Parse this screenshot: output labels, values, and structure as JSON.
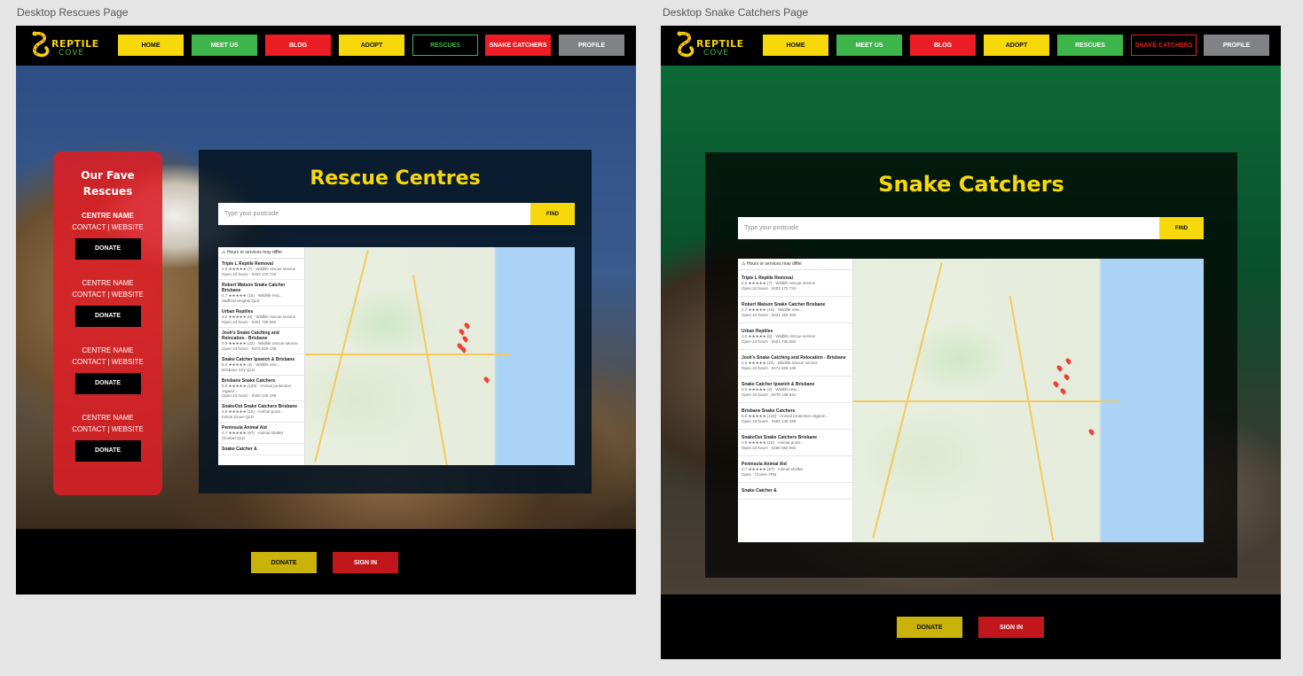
{
  "artboards": [
    {
      "label": "Desktop Rescues Page",
      "nav": [
        "HOME",
        "MEET US",
        "BLOG",
        "ADOPT",
        "RESCUES",
        "SNAKE CATCHERS",
        "PROFILE"
      ],
      "logo": {
        "line1": "REPTILE",
        "line2": "COVE"
      },
      "sidebar": {
        "title_line1": "Our Fave",
        "title_line2": "Rescues",
        "centres": [
          {
            "name": "CENTRE NAME",
            "links": "CONTACT | WEBSITE",
            "button": "DONATE"
          },
          {
            "name": "CENTRE NAME",
            "links": "CONTACT | WEBSITE",
            "button": "DONATE"
          },
          {
            "name": "CENTRE NAME",
            "links": "CONTACT | WEBSITE",
            "button": "DONATE"
          },
          {
            "name": "CENTRE NAME",
            "links": "CONTACT | WEBSITE",
            "button": "DONATE"
          }
        ]
      },
      "main": {
        "title": "Rescue Centres",
        "search_placeholder": "Type your postcode",
        "find": "FIND",
        "map_warning": "Hours or services may differ",
        "listings": [
          {
            "name": "Triple L Reptile Removal",
            "meta": "4.9 ★★★★★ (7) · Wildlife rescue service",
            "meta2": "Open 24 hours · 0403 170 734"
          },
          {
            "name": "Robert Watson Snake Catcher Brisbane",
            "meta": "4.7 ★★★★★ (15) · Wildlife resc...",
            "meta2": "Stafford Heights QLD"
          },
          {
            "name": "Urban Reptiles",
            "meta": "4.2 ★★★★★ (8) · Wildlife rescue service",
            "meta2": "Open 24 hours · 0401 735 592"
          },
          {
            "name": "Josh's Snake Catching and Relocation - Brisbane",
            "meta": "4.9 ★★★★★ (23) · Wildlife rescue service",
            "meta2": "Open 24 hours · 0474 828 138"
          },
          {
            "name": "Snake Catcher Ipswich & Brisbane",
            "meta": "5.0 ★★★★★ (2) · Wildlife resc...",
            "meta2": "Brisbane City QLD"
          },
          {
            "name": "Brisbane Snake Catchers",
            "meta": "5.0 ★★★★★ (120) · Animal protection organiz...",
            "meta2": "Open 24 hours · 0404 148 199"
          },
          {
            "name": "SnakeOut Snake Catchers Brisbane",
            "meta": "4.9 ★★★★★ (10) · Animal prote...",
            "meta2": "Kelvin Grove QLD"
          },
          {
            "name": "Peninsula Animal Aid",
            "meta": "4.7 ★★★★★ (67) · Animal shelter",
            "meta2": "Clontarf QLD"
          },
          {
            "name": "Snake Catcher &",
            "meta": "",
            "meta2": ""
          }
        ]
      },
      "footer": {
        "donate": "DONATE",
        "signin": "SIGN IN"
      }
    },
    {
      "label": "Desktop Snake Catchers Page",
      "nav": [
        "HOME",
        "MEET US",
        "BLOG",
        "ADOPT",
        "RESCUES",
        "SNAKE CATCHERS",
        "PROFILE"
      ],
      "logo": {
        "line1": "REPTILE",
        "line2": "COVE"
      },
      "main": {
        "title": "Snake Catchers",
        "search_placeholder": "Type your postcode",
        "find": "FIND",
        "map_warning": "Hours or services may differ",
        "listings": [
          {
            "name": "Triple L Reptile Removal",
            "meta": "4.9 ★★★★★ (7) · Wildlife rescue service",
            "meta2": "Open 24 hours · 0403 170 734"
          },
          {
            "name": "Robert Watson Snake Catcher Brisbane",
            "meta": "4.7 ★★★★★ (15) · Wildlife resc...",
            "meta2": "Open 24 hours · 0431 184 492"
          },
          {
            "name": "Urban Reptiles",
            "meta": "4.2 ★★★★★ (8) · Wildlife rescue service",
            "meta2": "Open 24 hours · 0401 735 592"
          },
          {
            "name": "Josh's Snake Catching and Relocation - Brisbane",
            "meta": "4.9 ★★★★★ (23) · Wildlife rescue service",
            "meta2": "Open 24 hours · 0474 828 138"
          },
          {
            "name": "Snake Catcher Ipswich & Brisbane",
            "meta": "5.0 ★★★★★ (2) · Wildlife resc...",
            "meta2": "Open 24 hours · 0478 138 941"
          },
          {
            "name": "Brisbane Snake Catchers",
            "meta": "5.0 ★★★★★ (120) · Animal protection organiz...",
            "meta2": "Open 24 hours · 0404 148 199"
          },
          {
            "name": "SnakeOut Snake Catchers Brisbane",
            "meta": "4.9 ★★★★★ (10) · Animal prote...",
            "meta2": "Open 24 hours · 0456 660 693"
          },
          {
            "name": "Peninsula Animal Aid",
            "meta": "4.7 ★★★★★ (67) · Animal shelter",
            "meta2": "Open · Closes 7PM"
          },
          {
            "name": "Snake Catcher &",
            "meta": "",
            "meta2": ""
          }
        ]
      },
      "footer": {
        "donate": "DONATE",
        "signin": "SIGN IN"
      }
    }
  ],
  "colors": {
    "yellow": "#f7d90b",
    "green": "#3cb54a",
    "red": "#ec1c24",
    "grey": "#808285"
  }
}
